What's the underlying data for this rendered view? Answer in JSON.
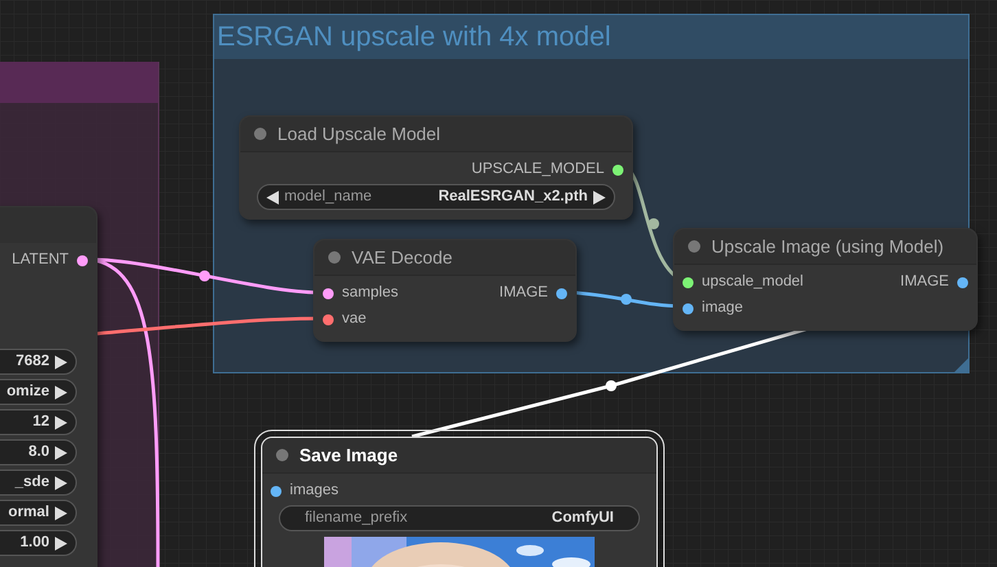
{
  "groups": [
    {
      "title": "ESRGAN upscale with 4x model"
    }
  ],
  "nodes": [
    {
      "selected": false,
      "outputs": [
        {
          "name": "LATENT",
          "color": "#ff9cf9"
        }
      ],
      "widgets": [
        {
          "kind": "clipped",
          "value": "7682"
        },
        {
          "kind": "clipped",
          "value": "omize"
        },
        {
          "kind": "clipped",
          "value": "12"
        },
        {
          "kind": "clipped",
          "value": "8.0"
        },
        {
          "kind": "clipped",
          "value": "_sde"
        },
        {
          "kind": "clipped",
          "value": "ormal"
        },
        {
          "kind": "clipped",
          "value": "1.00"
        }
      ]
    },
    {
      "title": "Load Upscale Model",
      "selected": false,
      "outputs": [
        {
          "name": "UPSCALE_MODEL",
          "color": "#7df275"
        }
      ],
      "widgets": [
        {
          "kind": "combo",
          "label": "model_name",
          "value": "RealESRGAN_x2.pth"
        }
      ]
    },
    {
      "title": "VAE Decode",
      "selected": false,
      "inputs": [
        {
          "name": "samples",
          "color": "#ff9cf9"
        },
        {
          "name": "vae",
          "color": "#ff6e6e"
        }
      ],
      "outputs": [
        {
          "name": "IMAGE",
          "color": "#64b5f6"
        }
      ]
    },
    {
      "title": "Upscale Image (using Model)",
      "selected": false,
      "inputs": [
        {
          "name": "upscale_model",
          "color": "#7df275"
        },
        {
          "name": "image",
          "color": "#64b5f6"
        }
      ],
      "outputs": [
        {
          "name": "IMAGE",
          "color": "#64b5f6"
        }
      ]
    },
    {
      "title": "Save Image",
      "selected": true,
      "inputs": [
        {
          "name": "images",
          "color": "#64b5f6"
        }
      ],
      "widgets": [
        {
          "kind": "text",
          "label": "filename_prefix",
          "value": "ComfyUI"
        }
      ],
      "preview": {
        "kind": "picture"
      }
    }
  ]
}
